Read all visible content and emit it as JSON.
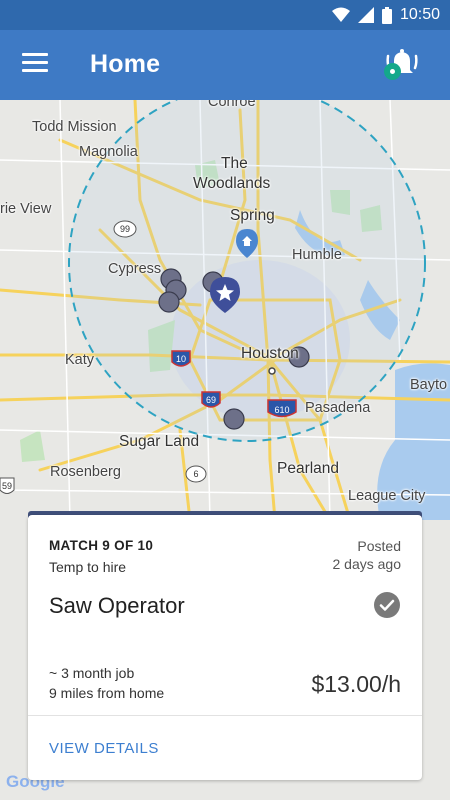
{
  "status_bar": {
    "time": "10:50",
    "icons": [
      "wifi-icon",
      "signal-icon",
      "battery-icon"
    ]
  },
  "app_bar": {
    "title": "Home",
    "menu_icon": "hamburger-menu-icon",
    "alert_icon": "bell-alert-icon"
  },
  "map": {
    "labels": {
      "conroe": "Conroe",
      "todd_mission": "Todd Mission",
      "magnolia": "Magnolia",
      "the": "The",
      "woodlands": "Woodlands",
      "prairie_view": "rie View",
      "spring": "Spring",
      "humble": "Humble",
      "cypress": "Cypress",
      "katy": "Katy",
      "houston": "Houston",
      "baytown": "Bayto",
      "pasadena": "Pasadena",
      "sugar_land": "Sugar Land",
      "rosenberg": "Rosenberg",
      "pearland": "Pearland",
      "league_city": "League City"
    },
    "highway_shields": {
      "h99": "99",
      "i10": "10",
      "i69": "69",
      "i610": "610",
      "h6": "6",
      "h59": "59"
    },
    "attribution": "Google",
    "colors": {
      "radius_ring": "#2ea3c2",
      "pin": "#6d7089",
      "home_marker": "#3f4f9a",
      "place_marker": "#4a86d0"
    }
  },
  "job_card": {
    "match_label": "MATCH 9 OF 10",
    "job_type": "Temp to hire",
    "posted_label": "Posted",
    "posted_ago": "2 days ago",
    "title": "Saw Operator",
    "duration": "~ 3 month job",
    "distance": "9 miles from home",
    "pay": "$13.00/h",
    "action_label": "VIEW DETAILS",
    "accent_color": "#3d7fd0"
  }
}
